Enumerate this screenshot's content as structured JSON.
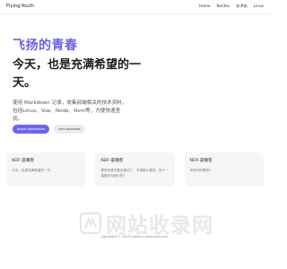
{
  "header": {
    "brand": "Flying-Youth",
    "nav": [
      "Home",
      "Nvideo",
      "技术贴",
      "Linux"
    ]
  },
  "hero": {
    "title": "飞扬的青春",
    "subtitle": "今天，也是充满希望的一天。",
    "description": "使用 Markdown 记录，收集前端相关的技术资料，包括Linux、Vue、Node、Nvm等，方便快速查找。",
    "primary_button": "pnpm-workspace",
    "secondary_button": "nvm-windows"
  },
  "cards": [
    {
      "title": "NDF-晨曦客",
      "text": "今天，也是充满希望的一天。"
    },
    {
      "title": "NDF-晨曦客",
      "text": "看来你是在要去那边了，不用那么着急，找个一直指在向我们的！"
    },
    {
      "title": "NDF-晨曦客",
      "text": "你的代码是啥?"
    }
  ],
  "watermark": {
    "text": "网站收录网",
    "url": "www.wzsl.com"
  },
  "footer": {
    "copyright": "Copyright © 2019-present www.wzsl.com"
  },
  "colors": {
    "accent": "#6b5ee8",
    "button_primary": "#6f63f0",
    "card_bg": "#f6f6f8"
  }
}
